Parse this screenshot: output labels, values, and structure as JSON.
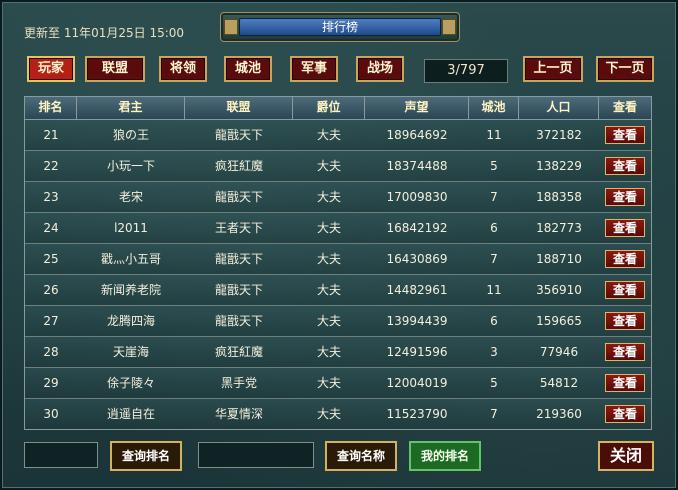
{
  "header": {
    "update_text": "更新至 11年01月25日 15:00",
    "title": "排行榜"
  },
  "tabs": [
    {
      "label": "玩家",
      "active": true
    },
    {
      "label": "联盟",
      "active": false
    },
    {
      "label": "将领",
      "active": false
    },
    {
      "label": "城池",
      "active": false
    },
    {
      "label": "军事",
      "active": false
    },
    {
      "label": "战场",
      "active": false
    }
  ],
  "pager": {
    "page_text": "3/797",
    "prev_label": "上一页",
    "next_label": "下一页"
  },
  "table": {
    "columns": [
      "排名",
      "君主",
      "联盟",
      "爵位",
      "声望",
      "城池",
      "人口",
      "查看"
    ],
    "view_label": "查看",
    "rows": [
      [
        "21",
        "狼の王",
        "龍戩天下",
        "大夫",
        "18964692",
        "11",
        "372182"
      ],
      [
        "22",
        "小玩一下",
        "疯狂紅魔",
        "大夫",
        "18374488",
        "5",
        "138229"
      ],
      [
        "23",
        "老宋",
        "龍戩天下",
        "大夫",
        "17009830",
        "7",
        "188358"
      ],
      [
        "24",
        "l2011",
        "王者天下",
        "大夫",
        "16842192",
        "6",
        "182773"
      ],
      [
        "25",
        "戳灬小五哥",
        "龍戩天下",
        "大夫",
        "16430869",
        "7",
        "188710"
      ],
      [
        "26",
        "新闻养老院",
        "龍戩天下",
        "大夫",
        "14482961",
        "11",
        "356910"
      ],
      [
        "27",
        "龙腾四海",
        "龍戩天下",
        "大夫",
        "13994439",
        "6",
        "159665"
      ],
      [
        "28",
        "天崖海",
        "疯狂紅魔",
        "大夫",
        "12491596",
        "3",
        "77946"
      ],
      [
        "29",
        "俆子陵々",
        "黑手党",
        "大夫",
        "12004019",
        "5",
        "54812"
      ],
      [
        "30",
        "逍遥自在",
        "华夏情深",
        "大夫",
        "11523790",
        "7",
        "219360"
      ]
    ]
  },
  "footer": {
    "rank_input_value": "",
    "query_rank_label": "查询排名",
    "name_input_value": "",
    "query_name_label": "查询名称",
    "my_rank_label": "我的排名",
    "close_label": "关闭"
  },
  "colors": {
    "tab_active": "#b52015",
    "tab_inactive": "#5a0c0c",
    "gold_border": "#d2b25c",
    "my_rank_button": "#1d6a25"
  }
}
